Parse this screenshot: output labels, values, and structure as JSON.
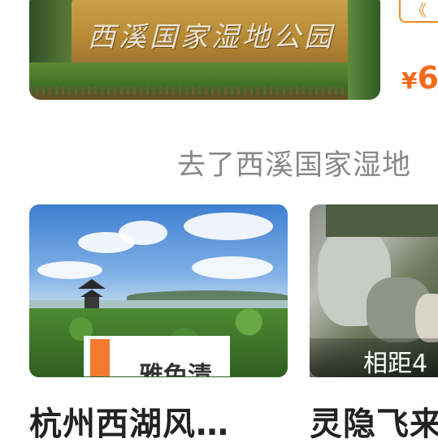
{
  "top_card": {
    "tag": "《",
    "price_symbol": "¥",
    "price_value": "6",
    "image_label": "西溪国家湿地公园"
  },
  "section": {
    "title": "去了西溪国家湿地"
  },
  "cards": [
    {
      "badge": "雅兔清",
      "title": "杭州西湖风…",
      "image": "west-lake-pavilion-photo"
    },
    {
      "distance": "相距4",
      "title": "灵隐飞来",
      "image": "lingyin-rock-buddha-photo"
    }
  ],
  "colors": {
    "accent": "#f36a1c",
    "tag_border": "#f08a28",
    "section_text": "#888888",
    "title_text": "#222222"
  }
}
